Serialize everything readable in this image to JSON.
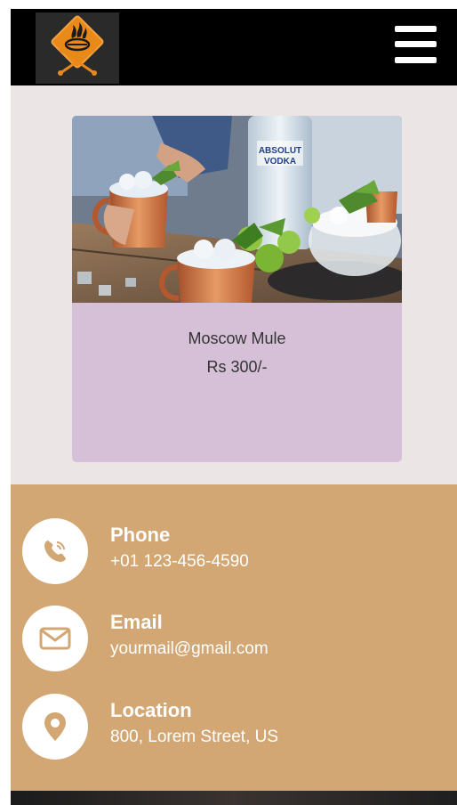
{
  "header": {
    "logo_name": "grill-logo",
    "menu_icon": "hamburger-menu-icon"
  },
  "product": {
    "image_icon": "moscow-mule-photo",
    "bottle_text_line1": "ABSOLUT",
    "bottle_text_line2": "VODKA",
    "name": "Moscow Mule",
    "price": "Rs 300/-"
  },
  "contact": {
    "items": [
      {
        "icon": "phone-icon",
        "title": "Phone",
        "value": "+01 123-456-4590"
      },
      {
        "icon": "envelope-icon",
        "title": "Email",
        "value": "yourmail@gmail.com"
      },
      {
        "icon": "location-pin-icon",
        "title": "Location",
        "value": "800, Lorem Street, US"
      }
    ]
  },
  "colors": {
    "header_bg": "#000000",
    "content_bg": "#ebe5e5",
    "card_bg": "#d6c0d8",
    "contact_bg": "#d2a774",
    "logo_accent": "#e8891a",
    "icon_color": "#d2a774"
  }
}
